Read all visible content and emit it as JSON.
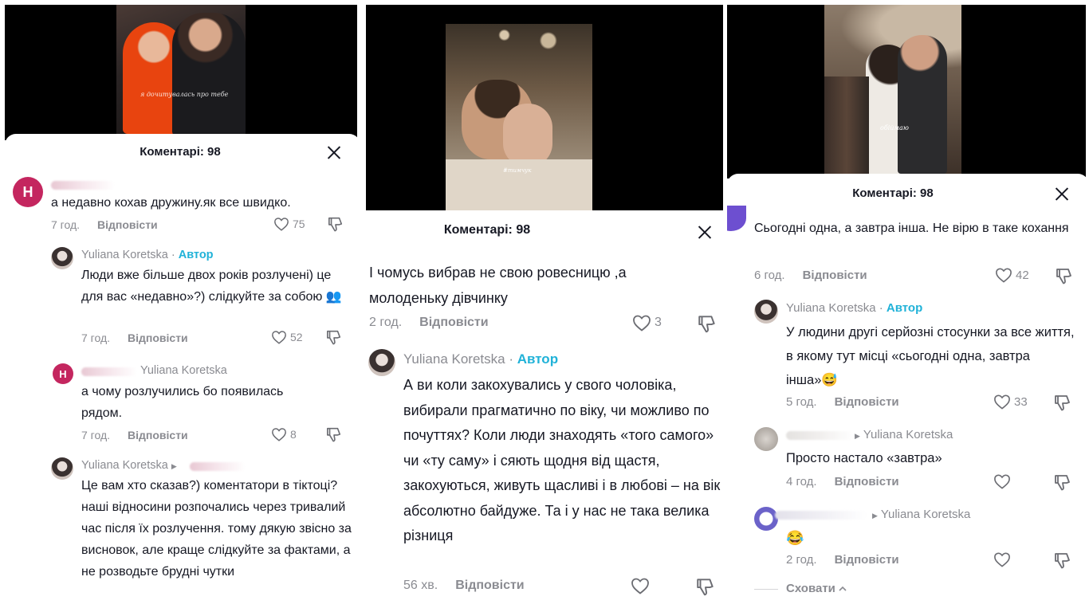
{
  "panels": [
    {
      "sheet_title": "Коментарі: 98",
      "video_caption": "я дочитувалась про тебе",
      "comments": [
        {
          "avatar_letter": "Н",
          "author": "",
          "text": "а недавно кохав дружину.як все швидко.",
          "time": "7 год.",
          "reply": "Відповісти",
          "likes": "75"
        },
        {
          "author": "Yuliana Koretska",
          "author_tag": "Автор",
          "text": "Люди вже більше двох років розлучені) це для вас «недавно»?) слідкуйте за собою 👥",
          "time": "7 год.",
          "reply": "Відповісти",
          "likes": "52"
        },
        {
          "avatar_letter": "Н",
          "reply_to": "Yuliana Koretska",
          "text": "а чому розлучились бо появилась рядом.",
          "time": "7 год.",
          "reply": "Відповісти",
          "likes": "8"
        },
        {
          "author": "Yuliana Koretska",
          "text": "Це вам хто сказав?) коментатори в тіктоці? наші відносини розпочались через тривалий час після їх розлучення. тому дякую звісно за висновок, але краще слідкуйте за фактами, а не розводьте брудні чутки"
        }
      ]
    },
    {
      "sheet_title": "Коментарі: 98",
      "video_caption": "#тимчук",
      "comments": [
        {
          "text": "І чомусь вибрав не свою ровесницю ,а молоденьку дівчинку",
          "time": "2 год.",
          "reply": "Відповісти",
          "likes": "3"
        },
        {
          "author": "Yuliana Koretska",
          "author_tag": "Автор",
          "text": "А ви коли закохувались у свого чоловіка, вибирали прагматично по віку, чи можливо по почуттях? Коли люди знаходять «того самого» чи «ту саму» і сяють щодня від щастя, закохуються, живуть щасливі і в любові – на вік абсолютно байдуже. Та і у нас не така велика різниця",
          "time": "56 хв.",
          "reply": "Відповісти",
          "likes": ""
        }
      ]
    },
    {
      "sheet_title": "Коментарі: 98",
      "video_caption": "обіймаю",
      "comments": [
        {
          "text": "Сьогодні одна, а завтра інша. Не вірю в таке кохання",
          "time": "6 год.",
          "reply": "Відповісти",
          "likes": "42"
        },
        {
          "author": "Yuliana Koretska",
          "author_tag": "Автор",
          "text": "У людини другі серйозні стосунки за все життя, в якому тут місці «сьогодні одна, завтра інша»😅",
          "time": "5 год.",
          "reply": "Відповісти",
          "likes": "33"
        },
        {
          "reply_to": "Yuliana Koretska",
          "text": "Просто настало «завтра»",
          "time": "4 год.",
          "reply": "Відповісти",
          "likes": ""
        },
        {
          "reply_to": "Yuliana Koretska",
          "text": "😂",
          "time": "2 год.",
          "reply": "Відповісти",
          "likes": ""
        }
      ],
      "hide_label": "Сховати"
    }
  ],
  "colors": {
    "author_tag": "#20b2d8",
    "avatar_h": "#c4265f",
    "muted": "#8a8b91"
  },
  "icons": {
    "like": "heart-icon",
    "dislike": "thumbs-down-icon",
    "close": "close-icon",
    "chevron": "chevron-up-icon",
    "reply_arrow": "reply-arrow-icon"
  }
}
